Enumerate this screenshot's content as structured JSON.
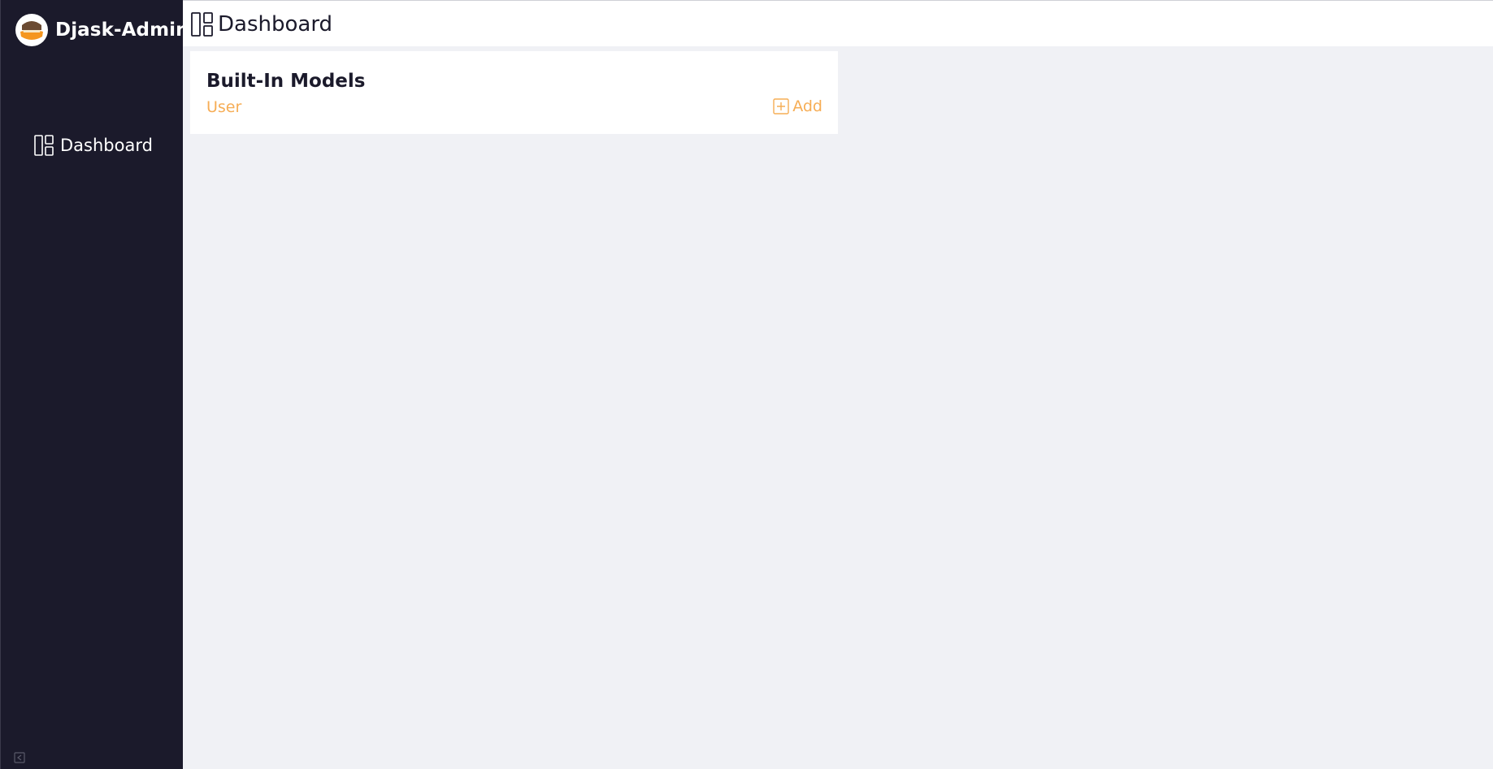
{
  "sidebar": {
    "brand": {
      "title": "Djask-Admin",
      "logo_icon": "djask-logo-icon"
    },
    "items": [
      {
        "label": "Dashboard",
        "icon": "dashboard-icon"
      }
    ]
  },
  "header": {
    "title": "Dashboard",
    "icon": "dashboard-icon"
  },
  "main": {
    "cards": [
      {
        "title": "Built-In Models",
        "models": [
          {
            "name": "User",
            "add_label": "Add",
            "add_icon": "plus-square-icon"
          }
        ]
      }
    ]
  },
  "colors": {
    "sidebar_bg": "#1b1a2b",
    "content_bg": "#f0f1f5",
    "accent": "#f6ad55",
    "text_dark": "#1b1a2b"
  }
}
